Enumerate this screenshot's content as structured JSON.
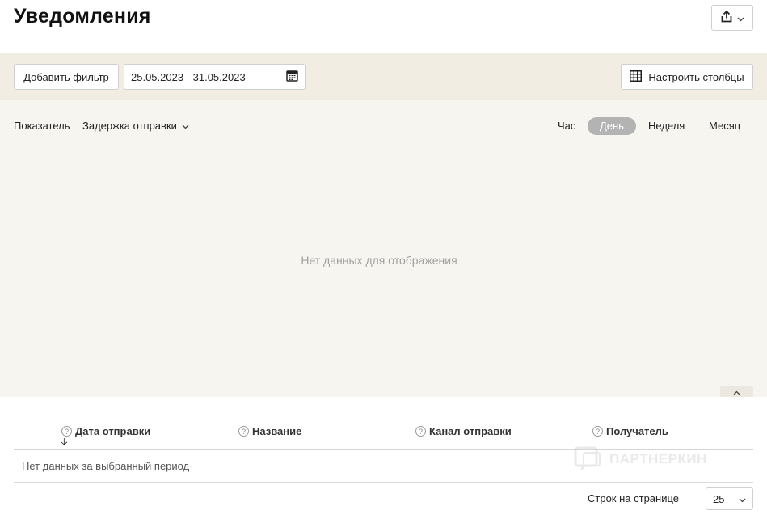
{
  "page": {
    "title": "Уведомления"
  },
  "header": {
    "export_icon": "share-upload-icon"
  },
  "filters": {
    "add_filter_label": "Добавить фильтр",
    "date_range": "25.05.2023 - 31.05.2023",
    "columns_label": "Настроить столбцы"
  },
  "chart": {
    "metric_label": "Показатель",
    "metric_value": "Задержка отправки",
    "periods": {
      "hour": "Час",
      "day": "День",
      "week": "Неделя",
      "month": "Месяц"
    },
    "selected_period": "День",
    "no_data": "Нет данных для отображения"
  },
  "table": {
    "columns": [
      "Дата отправки",
      "Название",
      "Канал отправки",
      "Получатель"
    ],
    "sort_column": "Дата отправки",
    "empty_text": "Нет данных за выбранный период"
  },
  "pagination": {
    "rows_label": "Строк на странице",
    "rows_value": "25"
  },
  "watermark": {
    "text": "ПАРТНЕРКИН"
  },
  "colors": {
    "filter_bar_bg": "#f1ede3",
    "chart_bg": "#f7f5f0",
    "active_period_bg": "#b3b3b3"
  }
}
